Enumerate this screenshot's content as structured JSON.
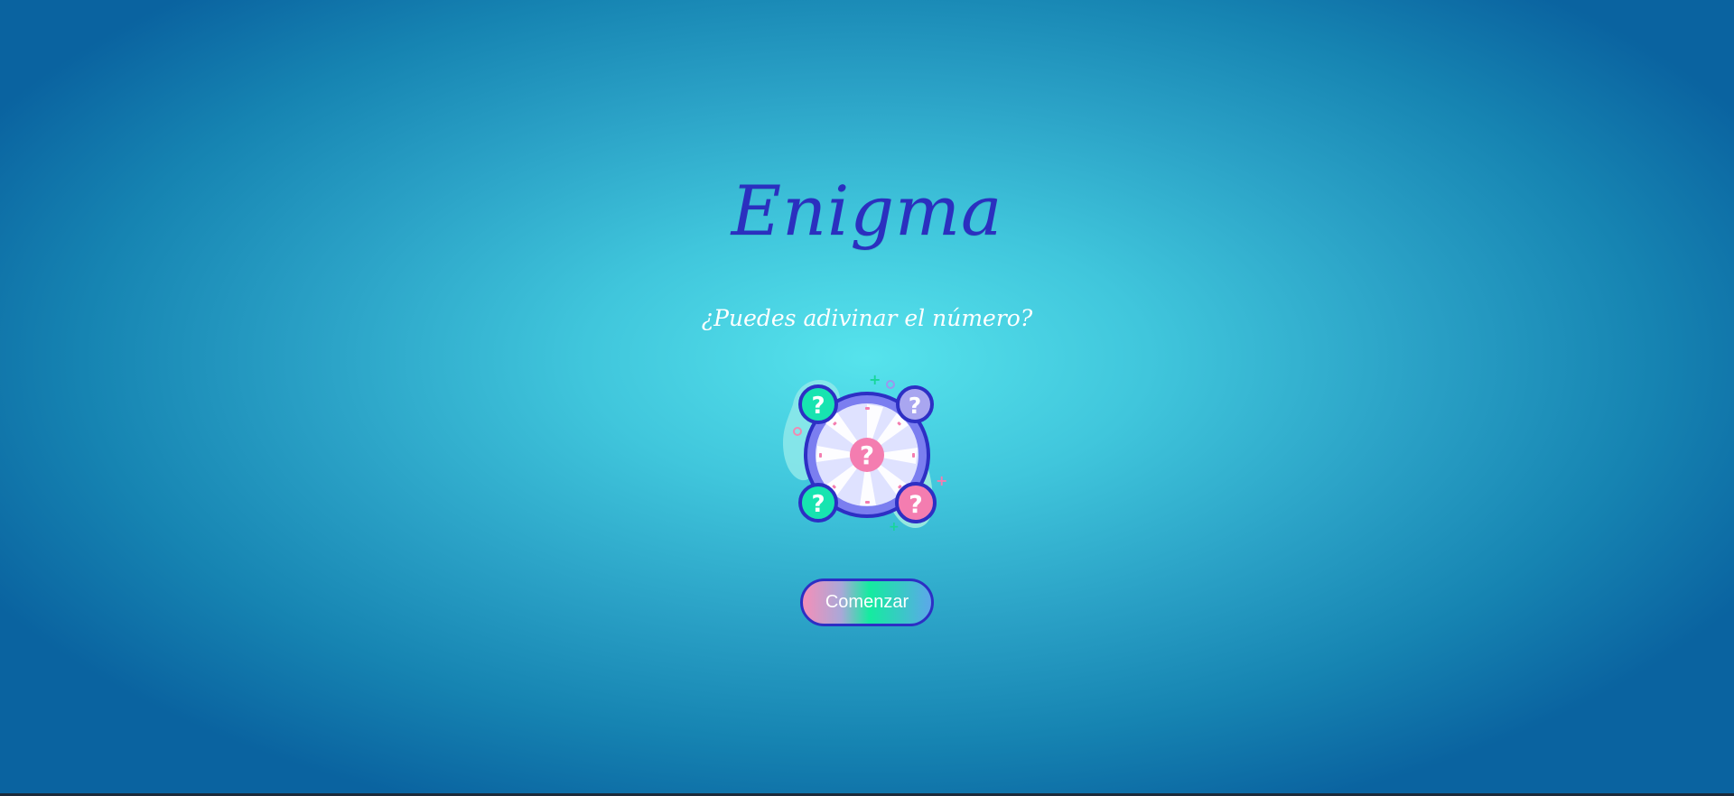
{
  "app": {
    "title": "Enigma",
    "subtitle": "¿Puedes adivinar el número?"
  },
  "hero": {
    "icon": "question-wheel-icon",
    "icon_glyph": "?"
  },
  "actions": {
    "start_label": "Comenzar"
  },
  "colors": {
    "title": "#2b2fbf",
    "accent_pink": "#f47db0",
    "accent_green": "#17e4b0",
    "accent_lavender": "#a9a6f0",
    "background_center": "#56e3ec",
    "background_edge": "#0a63a0"
  }
}
